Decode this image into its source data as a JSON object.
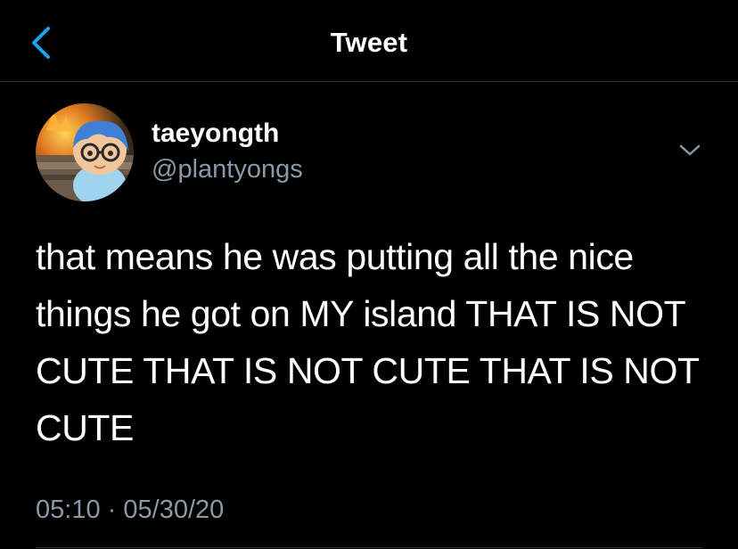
{
  "header": {
    "title": "Tweet",
    "back_icon": "chevron-left-icon",
    "accent_color": "#1da1f2"
  },
  "tweet": {
    "display_name": "taeyongth",
    "handle": "@plantyongs",
    "avatar": "avatar-image",
    "menu_icon": "chevron-down-icon",
    "text": "that means he was putting all the nice things he got on MY island THAT IS NOT CUTE THAT IS NOT CUTE THAT IS NOT CUTE",
    "time": "05:10",
    "separator": "·",
    "date": "05/30/20"
  },
  "colors": {
    "background": "#000000",
    "primary_text": "#ffffff",
    "secondary_text": "#8b98a5",
    "divider": "#2f3336"
  }
}
